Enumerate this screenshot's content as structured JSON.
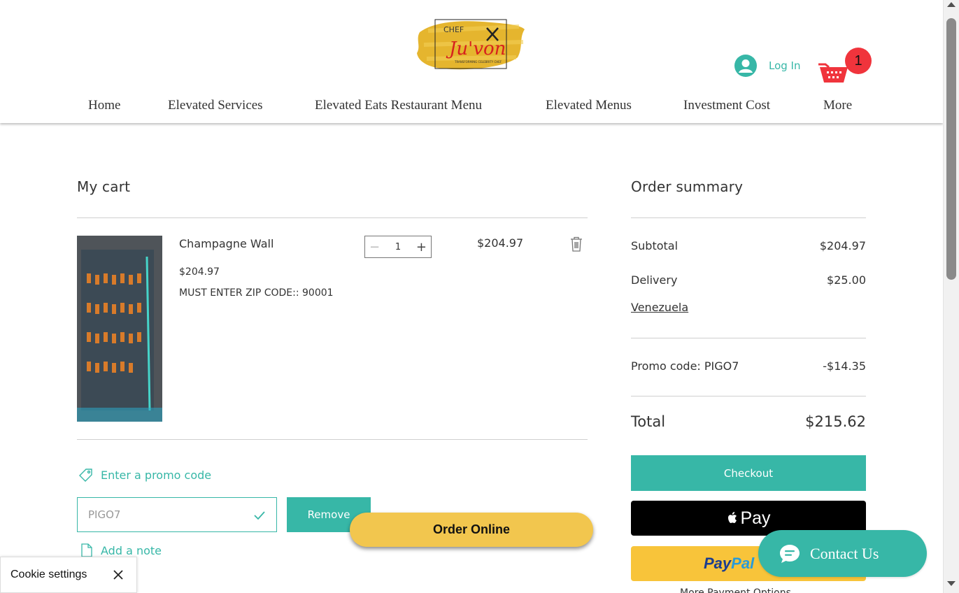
{
  "header": {
    "logo_text_top": "CHEF",
    "logo_text_main": "Ju'von",
    "logo_text_sub": "TRANSFORMING CELEBRITY CHEF",
    "login_label": "Log In",
    "cart_count": "1"
  },
  "nav": {
    "items": [
      "Home",
      "Elevated Services",
      "Elevated Eats Restaurant Menu",
      "Elevated Menus",
      "Investment Cost",
      "More"
    ]
  },
  "cart": {
    "title": "My cart",
    "item": {
      "name": "Champagne Wall",
      "unit_price": "$204.97",
      "option": "MUST ENTER ZIP CODE:: 90001",
      "quantity": "1",
      "line_total": "$204.97",
      "quantity_minus": "−",
      "quantity_plus": "+"
    },
    "promo_link": "Enter a promo code",
    "promo_value": "PIGO7",
    "remove_label": "Remove",
    "note_link": "Add a note"
  },
  "summary": {
    "title": "Order summary",
    "subtotal_label": "Subtotal",
    "subtotal_value": "$204.97",
    "delivery_label": "Delivery",
    "delivery_value": "$25.00",
    "delivery_country": "Venezuela",
    "promo_label": "Promo code: PIGO7",
    "promo_value": "-$14.35",
    "total_label": "Total",
    "total_value": "$215.62",
    "checkout_label": "Checkout",
    "applepay_label": "Pay",
    "paypal_part1": "Pay",
    "paypal_part2": "Pal",
    "more_payment": "More Payment Options"
  },
  "floating": {
    "order_online": "Order Online",
    "contact_us": "Contact Us"
  },
  "cookie": {
    "label": "Cookie settings"
  },
  "colors": {
    "accent": "#37b7a7",
    "badge": "#f0343c",
    "order_online": "#f2c64e",
    "paypal": "#f8c43a"
  }
}
